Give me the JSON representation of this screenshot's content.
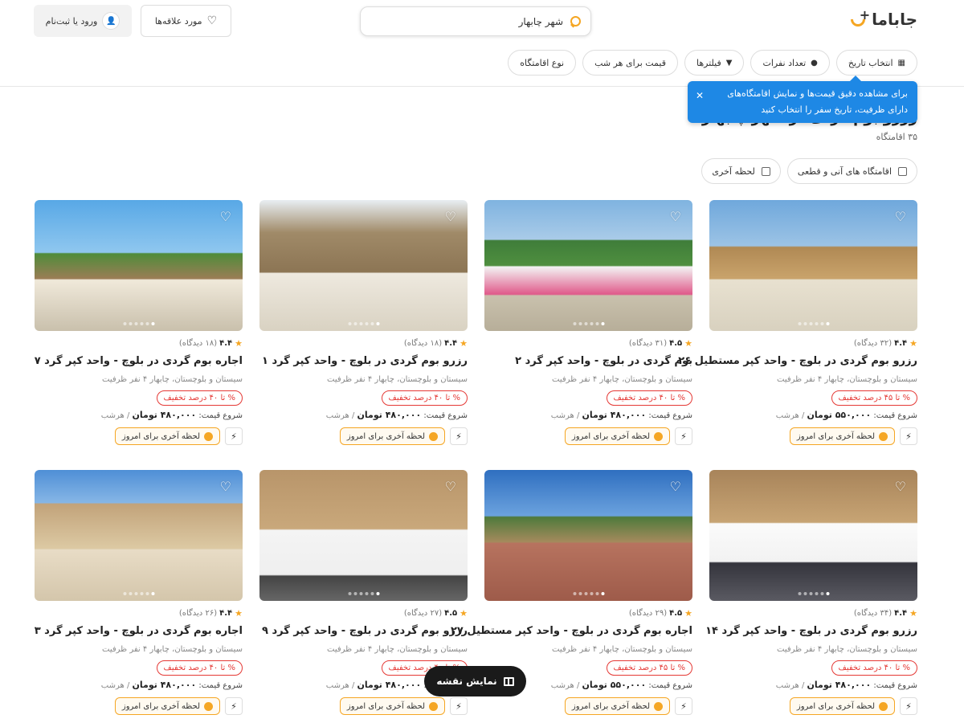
{
  "header": {
    "logo_text": "جاباما",
    "search_value": "شهر چابهار",
    "favorites_label": "مورد علاقه‌ها",
    "login_label": "ورود یا ثبت‌نام"
  },
  "filters": [
    {
      "label": "انتخاب تاریخ",
      "icon": "calendar-icon"
    },
    {
      "label": "تعداد نفرات",
      "icon": "person-icon"
    },
    {
      "label": "فیلترها",
      "icon": "filter-icon"
    },
    {
      "label": "قیمت برای هر شب",
      "icon": ""
    },
    {
      "label": "نوع اقامتگاه",
      "icon": ""
    }
  ],
  "tooltip": {
    "line1": "برای مشاهده دقیق قیمت‌ها و نمایش اقامتگاه‌های",
    "line2": "دارای ظرفیت، تاریخ سفر را انتخاب کنید"
  },
  "page": {
    "title": "رزرو بوم گردی در شهر چابهار",
    "count": "۳۵ اقامتگاه"
  },
  "toggles": [
    {
      "label": "اقامتگاه های آنی و قطعی"
    },
    {
      "label": "لحظه آخری"
    }
  ],
  "cards": [
    {
      "score": "۴.۴",
      "reviews": "(۳۲ دیدگاه)",
      "title": "رزرو بوم گردی در بلوچ - واحد کپر مستطیل ۲۶",
      "sub": "سیستان و بلوچستان، چابهار ۴ نفر ظرفیت",
      "discount": "% تا ۴۵ درصد تخفیف",
      "price_prefix": "شروع قیمت:",
      "price": "۵۵۰,۰۰۰ تومان",
      "per": "/ هرشب",
      "lastmin": "لحظه آخری برای امروز"
    },
    {
      "score": "۴.۵",
      "reviews": "(۳۱ دیدگاه)",
      "title": "بوم گردی در بلوچ - واحد کپر گرد ۲",
      "sub": "سیستان و بلوچستان، چابهار ۴ نفر ظرفیت",
      "discount": "% تا ۴۰ درصد تخفیف",
      "price_prefix": "شروع قیمت:",
      "price": "۴۸۰,۰۰۰ تومان",
      "per": "/ هرشب",
      "lastmin": "لحظه آخری برای امروز"
    },
    {
      "score": "۴.۴",
      "reviews": "(۱۸ دیدگاه)",
      "title": "رزرو بوم گردی در بلوچ - واحد کپر گرد ۱",
      "sub": "سیستان و بلوچستان، چابهار ۴ نفر ظرفیت",
      "discount": "% تا ۴۰ درصد تخفیف",
      "price_prefix": "شروع قیمت:",
      "price": "۴۸۰,۰۰۰ تومان",
      "per": "/ هرشب",
      "lastmin": "لحظه آخری برای امروز"
    },
    {
      "score": "۴.۴",
      "reviews": "(۱۸ دیدگاه)",
      "title": "اجاره بوم گردی در بلوچ - واحد کپر گرد ۷",
      "sub": "سیستان و بلوچستان، چابهار ۴ نفر ظرفیت",
      "discount": "% تا ۴۰ درصد تخفیف",
      "price_prefix": "شروع قیمت:",
      "price": "۴۸۰,۰۰۰ تومان",
      "per": "/ هرشب",
      "lastmin": "لحظه آخری برای امروز"
    },
    {
      "score": "۴.۴",
      "reviews": "(۳۴ دیدگاه)",
      "title": "رزرو بوم گردی در بلوچ - واحد کپر گرد ۱۴",
      "sub": "سیستان و بلوچستان، چابهار ۴ نفر ظرفیت",
      "discount": "% تا ۴۰ درصد تخفیف",
      "price_prefix": "شروع قیمت:",
      "price": "۴۸۰,۰۰۰ تومان",
      "per": "/ هرشب",
      "lastmin": "لحظه آخری برای امروز"
    },
    {
      "score": "۴.۵",
      "reviews": "(۲۹ دیدگاه)",
      "title": "اجاره بوم گردی در بلوچ - واحد کپر مستطیل ۲۷",
      "sub": "سیستان و بلوچستان، چابهار ۴ نفر ظرفیت",
      "discount": "% تا ۴۵ درصد تخفیف",
      "price_prefix": "شروع قیمت:",
      "price": "۵۵۰,۰۰۰ تومان",
      "per": "/ هرشب",
      "lastmin": "لحظه آخری برای امروز"
    },
    {
      "score": "۴.۵",
      "reviews": "(۲۷ دیدگاه)",
      "title": "رزرو بوم گردی در بلوچ - واحد کپر گرد ۹",
      "sub": "سیستان و بلوچستان، چابهار ۴ نفر ظرفیت",
      "discount": "% تا ۴۰ درصد تخفیف",
      "price_prefix": "شروع قیمت:",
      "price": "۴۸۰,۰۰۰ تومان",
      "per": "/ هرشب",
      "lastmin": "لحظه آخری برای امروز"
    },
    {
      "score": "۴.۴",
      "reviews": "(۲۶ دیدگاه)",
      "title": "اجاره بوم گردی در بلوچ - واحد کپر گرد ۳",
      "sub": "سیستان و بلوچستان، چابهار ۴ نفر ظرفیت",
      "discount": "% تا ۴۰ درصد تخفیف",
      "price_prefix": "شروع قیمت:",
      "price": "۴۸۰,۰۰۰ تومان",
      "per": "/ هرشب",
      "lastmin": "لحظه آخری برای امروز"
    }
  ],
  "map_button": "نمایش نقشه",
  "colors": {
    "accent": "#f5a623",
    "discount": "#e53935",
    "tooltip": "#1e88e5"
  }
}
